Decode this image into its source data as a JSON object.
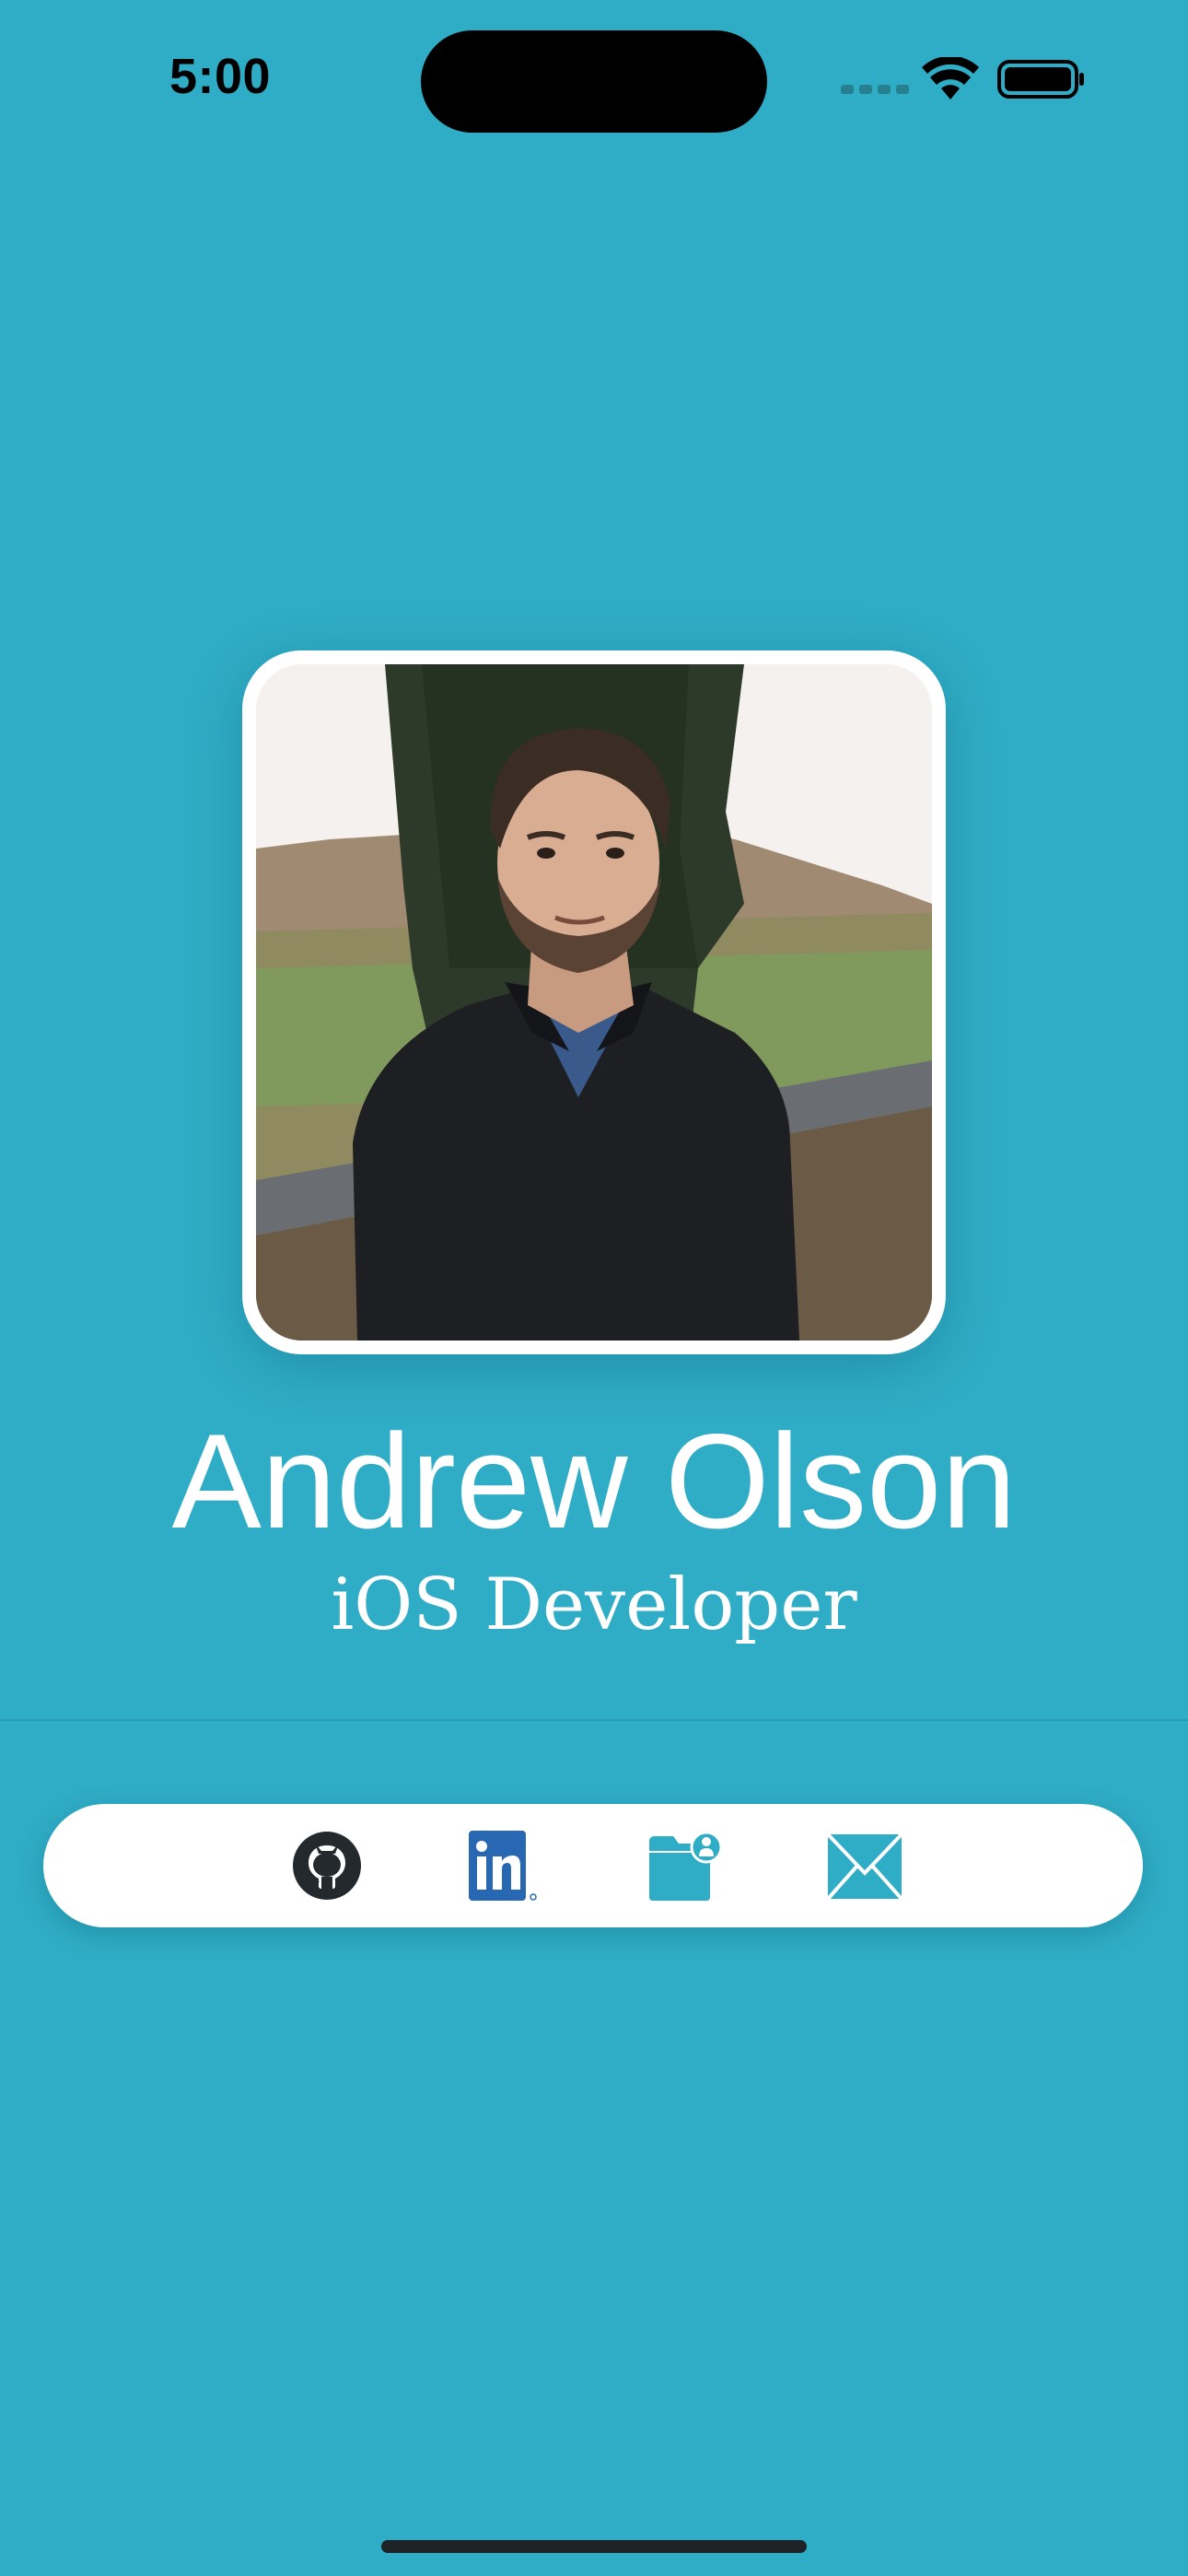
{
  "status_bar": {
    "time": "5:00"
  },
  "profile": {
    "name": "Andrew Olson",
    "title": "iOS Developer",
    "photo_alt": "Andrew Olson"
  },
  "social_links": [
    {
      "icon": "github-icon",
      "label": "GitHub"
    },
    {
      "icon": "linkedin-icon",
      "label": "LinkedIn"
    },
    {
      "icon": "portfolio-folder-icon",
      "label": "Portfolio"
    },
    {
      "icon": "email-icon",
      "label": "Email"
    }
  ],
  "colors": {
    "background": "#2fadc6",
    "card": "#ffffff",
    "github": "#24292e",
    "linkedin": "#2867b2",
    "accent": "#2fadc6",
    "text": "#ffffff"
  }
}
